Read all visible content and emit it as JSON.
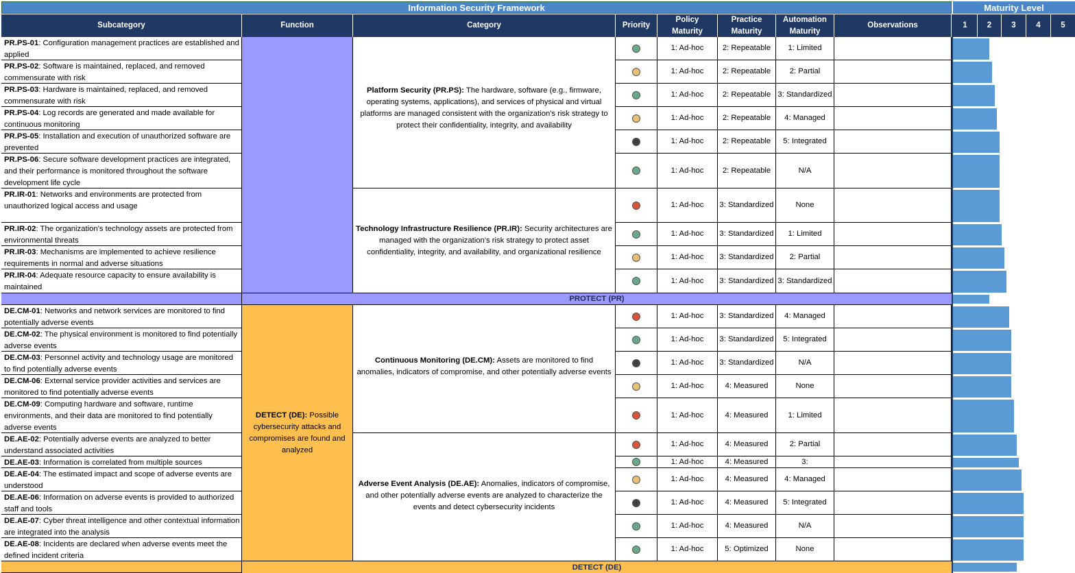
{
  "title": "Information Security Framework",
  "maturity_title": "Maturity Level",
  "headers": {
    "subcategory": "Subcategory",
    "function": "Function",
    "category": "Category",
    "priority": "Priority",
    "policy": "Policy Maturity",
    "practice": "Practice Maturity",
    "automation": "Automation Maturity",
    "observations": "Observations",
    "levels": [
      "1",
      "2",
      "3",
      "4",
      "5"
    ]
  },
  "colors": {
    "green": "#6aa88a",
    "yellow": "#e9c078",
    "dark": "#404040",
    "red": "#d9553a",
    "protect_fill": "#9999ff",
    "detect_fill": "#ffbf4f",
    "bar": "#5b9bd5",
    "header": "#1f3864"
  },
  "functions": {
    "protect": {
      "band_label": "PROTECT (PR)",
      "maturity": 1.5
    },
    "detect": {
      "id": "DETECT (DE):",
      "desc": " Possible cybersecurity attacks and compromises are found and analyzed",
      "band_label": "DETECT (DE)",
      "maturity": 2.6
    }
  },
  "categories": [
    {
      "id": "Platform Security (PR.PS):",
      "desc": " The hardware, software (e.g., firmware, operating systems, applications), and services of physical and virtual platforms are managed consistent with the organization's risk strategy to protect their confidentiality, integrity, and availability"
    },
    {
      "id": "Technology Infrastructure Resilience (PR.IR):",
      "desc": " Security architectures are managed with the organization's risk strategy to protect asset confidentiality, integrity, and availability, and organizational resilience"
    },
    {
      "id": "Continuous Monitoring (DE.CM):",
      "desc": " Assets are monitored to find anomalies, indicators of compromise, and other potentially adverse events"
    },
    {
      "id": "Adverse Event Analysis (DE.AE):",
      "desc": " Anomalies, indicators of compromise, and other potentially adverse events are analyzed to characterize the events and detect cybersecurity incidents"
    }
  ],
  "rows": [
    {
      "id": "PR.PS-01",
      "desc": ": Configuration management practices are established and applied",
      "priority": "green",
      "policy": "1: Ad-hoc",
      "practice": "2: Repeatable",
      "automation": "1: Limited",
      "maturity": 1.5
    },
    {
      "id": "PR.PS-02",
      "desc": ": Software is maintained, replaced, and removed commensurate with risk",
      "priority": "yellow",
      "policy": "1: Ad-hoc",
      "practice": "2: Repeatable",
      "automation": "2: Partial",
      "maturity": 1.6
    },
    {
      "id": "PR.PS-03",
      "desc": ": Hardware is maintained, replaced, and removed commensurate with risk",
      "priority": "green",
      "policy": "1: Ad-hoc",
      "practice": "2: Repeatable",
      "automation": "3: Standardized",
      "maturity": 1.7
    },
    {
      "id": "PR.PS-04",
      "desc": ": Log records are generated and made available for continuous monitoring",
      "priority": "yellow",
      "policy": "1: Ad-hoc",
      "practice": "2: Repeatable",
      "automation": "4: Managed",
      "maturity": 1.8
    },
    {
      "id": "PR.PS-05",
      "desc": ": Installation and execution of unauthorized software are prevented",
      "priority": "dark",
      "policy": "1: Ad-hoc",
      "practice": "2: Repeatable",
      "automation": "5: Integrated",
      "maturity": 1.9
    },
    {
      "id": "PR.PS-06",
      "desc": ": Secure software development practices are integrated, and their performance is monitored throughout the software development life cycle",
      "priority": "green",
      "policy": "1: Ad-hoc",
      "practice": "2: Repeatable",
      "automation": "N/A",
      "maturity": 1.9
    },
    {
      "id": "PR.IR-01",
      "desc": ": Networks and environments are protected from unauthorized logical access and usage",
      "priority": "red",
      "policy": "1: Ad-hoc",
      "practice": "3: Standardized",
      "automation": "None",
      "maturity": 1.9
    },
    {
      "id": "PR.IR-02",
      "desc": ": The organization's technology assets are protected from environmental threats",
      "priority": "green",
      "policy": "1: Ad-hoc",
      "practice": "3: Standardized",
      "automation": "1: Limited",
      "maturity": 2.0
    },
    {
      "id": "PR.IR-03",
      "desc": ": Mechanisms are implemented to achieve resilience requirements in normal and adverse situations",
      "priority": "yellow",
      "policy": "1: Ad-hoc",
      "practice": "3: Standardized",
      "automation": "2: Partial",
      "maturity": 2.1
    },
    {
      "id": "PR.IR-04",
      "desc": ": Adequate resource capacity to ensure availability is maintained",
      "priority": "green",
      "policy": "1: Ad-hoc",
      "practice": "3: Standardized",
      "automation": "3: Standardized",
      "maturity": 2.2
    },
    {
      "id": "DE.CM-01",
      "desc": ": Networks and network services are monitored to find potentially adverse events",
      "priority": "red",
      "policy": "1: Ad-hoc",
      "practice": "3: Standardized",
      "automation": "4: Managed",
      "maturity": 2.3
    },
    {
      "id": "DE.CM-02",
      "desc": ": The physical environment is monitored to find potentially adverse events",
      "priority": "green",
      "policy": "1: Ad-hoc",
      "practice": "3: Standardized",
      "automation": "5: Integrated",
      "maturity": 2.4
    },
    {
      "id": "DE.CM-03",
      "desc": ": Personnel activity and technology usage are monitored to find potentially adverse events",
      "priority": "dark",
      "policy": "1: Ad-hoc",
      "practice": "3: Standardized",
      "automation": "N/A",
      "maturity": 2.4
    },
    {
      "id": "DE.CM-06",
      "desc": ": External service provider activities and services are monitored to find potentially adverse events",
      "priority": "yellow",
      "policy": "1: Ad-hoc",
      "practice": "4: Measured",
      "automation": "None",
      "maturity": 2.4
    },
    {
      "id": "DE.CM-09",
      "desc": ": Computing hardware and software, runtime environments, and their data are monitored to find potentially adverse events",
      "priority": "red",
      "policy": "1: Ad-hoc",
      "practice": "4: Measured",
      "automation": "1: Limited",
      "maturity": 2.5
    },
    {
      "id": "DE.AE-02",
      "desc": ": Potentially adverse events are analyzed to better understand associated activities",
      "priority": "red",
      "policy": "1: Ad-hoc",
      "practice": "4: Measured",
      "automation": "2: Partial",
      "maturity": 2.6
    },
    {
      "id": "DE.AE-03",
      "desc": ": Information is correlated from multiple sources",
      "priority": "green",
      "policy": "1: Ad-hoc",
      "practice": "4: Measured",
      "automation": "3:",
      "maturity": 2.7
    },
    {
      "id": "DE.AE-04",
      "desc": ": The estimated impact and scope of adverse events are understood",
      "priority": "yellow",
      "policy": "1: Ad-hoc",
      "practice": "4: Measured",
      "automation": "4: Managed",
      "maturity": 2.8
    },
    {
      "id": "DE.AE-06",
      "desc": ": Information on adverse events is provided to authorized staff and tools",
      "priority": "dark",
      "policy": "1: Ad-hoc",
      "practice": "4: Measured",
      "automation": "5: Integrated",
      "maturity": 2.9
    },
    {
      "id": "DE.AE-07",
      "desc": ": Cyber threat intelligence and other contextual information are integrated into the analysis",
      "priority": "green",
      "policy": "1: Ad-hoc",
      "practice": "4: Measured",
      "automation": "N/A",
      "maturity": 2.9
    },
    {
      "id": "DE.AE-08",
      "desc": ": Incidents are declared when adverse events meet the defined incident criteria",
      "priority": "green",
      "policy": "1: Ad-hoc",
      "practice": "5: Optimized",
      "automation": "None",
      "maturity": 2.9
    }
  ]
}
